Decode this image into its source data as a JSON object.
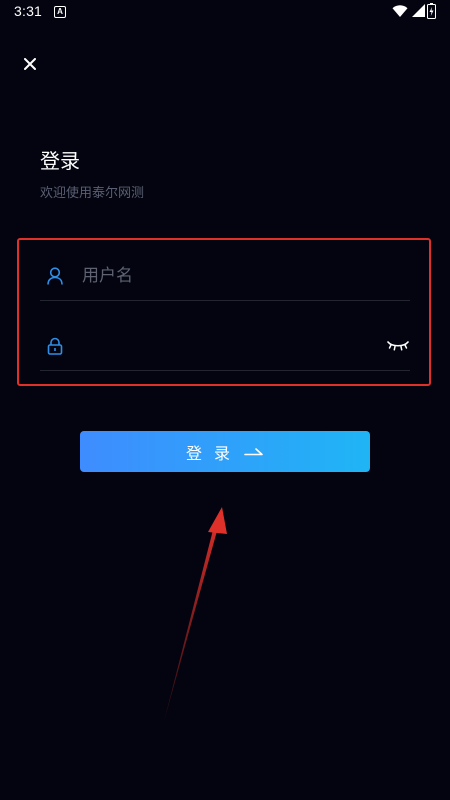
{
  "status_bar": {
    "time": "3:31",
    "notification_letter": "A"
  },
  "login": {
    "title": "登录",
    "subtitle": "欢迎使用泰尔网测",
    "username_placeholder": "用户名",
    "password_placeholder": "",
    "button_label": "登录"
  },
  "colors": {
    "background": "#03040f",
    "accent_start": "#3f8cff",
    "accent_end": "#1fb5f5",
    "icon_blue": "#2f8fe8",
    "annotation_red": "#e0302a"
  },
  "icons": {
    "close": "close-icon",
    "username": "user-icon",
    "password": "lock-icon",
    "password_visibility": "eye-closed-icon",
    "button_arrow": "arrow-right-icon"
  }
}
